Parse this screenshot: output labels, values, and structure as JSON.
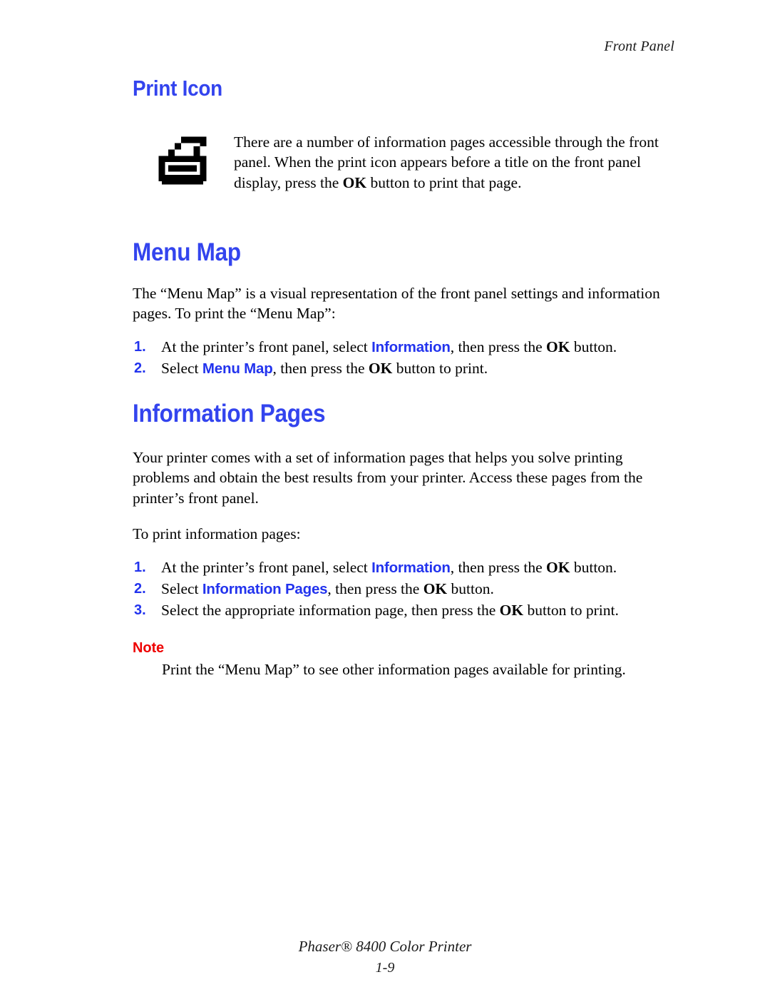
{
  "header": {
    "running_head": "Front Panel"
  },
  "sections": {
    "print_icon": {
      "title": "Print Icon",
      "icon_name": "printer-icon",
      "paragraph_pre": "There are a number of information pages accessible through the front panel. When the print icon appears before a title on the front panel display, press the ",
      "paragraph_bold": "OK",
      "paragraph_post": " button to print that page."
    },
    "menu_map": {
      "title": "Menu Map",
      "paragraph": "The “Menu Map” is a visual representation of the front panel settings and information pages. To print the “Menu Map”:",
      "steps": [
        {
          "num": "1.",
          "pre": "At the printer’s front panel, select ",
          "ui": "Information",
          "mid": ", then press the ",
          "bold": "OK",
          "post": " button."
        },
        {
          "num": "2.",
          "pre": "Select ",
          "ui": "Menu Map",
          "mid": ", then press the ",
          "bold": "OK",
          "post": " button to print."
        }
      ]
    },
    "information_pages": {
      "title": "Information Pages",
      "paragraph1": "Your printer comes with a set of information pages that helps you solve printing problems and obtain the best results from your printer. Access these pages from the printer’s front panel.",
      "paragraph2": "To print information pages:",
      "steps": [
        {
          "num": "1.",
          "pre": "At the printer’s front panel, select ",
          "ui": "Information",
          "mid": ", then press the ",
          "bold": "OK",
          "post": " button."
        },
        {
          "num": "2.",
          "pre": "Select ",
          "ui": "Information Pages",
          "mid": ", then press the ",
          "bold": "OK",
          "post": " button."
        },
        {
          "num": "3.",
          "pre": "Select the appropriate information page, then press the ",
          "ui": "",
          "mid": "",
          "bold": "OK",
          "post": " button to print."
        }
      ],
      "note": {
        "label": "Note",
        "text": "Print the “Menu Map” to see other information pages available for printing."
      }
    }
  },
  "footer": {
    "product": "Phaser® 8400 Color Printer",
    "page_number": "1-9"
  },
  "colors": {
    "heading_blue": "#3344ee",
    "ui_blue": "#2233ee",
    "note_red": "#ee0000",
    "text_black": "#000000"
  }
}
